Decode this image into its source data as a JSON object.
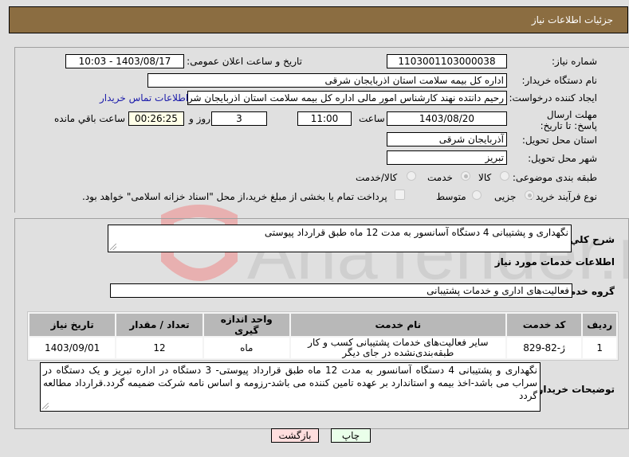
{
  "header": {
    "title": "جزئیات اطلاعات نیاز"
  },
  "fields": {
    "need_number": {
      "label": "شماره نیاز:",
      "value": "1103001103000038"
    },
    "announce_datetime": {
      "label": "تاریخ و ساعت اعلان عمومی:",
      "value": "1403/08/17 - 10:03"
    },
    "buyer_org": {
      "label": "نام دستگاه خریدار:",
      "value": "اداره کل بیمه سلامت استان اذربایجان شرقی"
    },
    "requester": {
      "label": "ایجاد کننده درخواست:",
      "value": "رحیم  دانتده نهند کارشناس امور مالی اداره کل بیمه سلامت استان اذربایجان شرقی"
    },
    "buyer_contact_link": "اطلاعات تماس خریدار",
    "deadline": {
      "label": "مهلت ارسال پاسخ: تا تاریخ:",
      "date": "1403/08/20",
      "time_label": "ساعت",
      "time": "11:00",
      "days": "3",
      "days_label": "روز و",
      "remaining": "00:26:25",
      "remaining_label": "ساعت باقي مانده"
    },
    "province": {
      "label": "استان محل تحویل:",
      "value": "آذربایجان شرقی"
    },
    "city": {
      "label": "شهر محل تحویل:",
      "value": "تبریز"
    },
    "category": {
      "label": "طبقه بندی موضوعی:",
      "options": [
        "کالا",
        "خدمت",
        "کالا/خدمت"
      ],
      "selected": "خدمت"
    },
    "purchase_type": {
      "label": "نوع فرآیند خرید :",
      "options": [
        "جزیی",
        "متوسط"
      ],
      "selected": "جزیی",
      "treasury_checkbox_label": "پرداخت تمام یا بخشی از مبلغ خرید،از محل \"اسناد خزانه اسلامی\" خواهد بود.",
      "treasury_checked": false
    }
  },
  "summary": {
    "label": "شرح کلي نياز:",
    "value": "نگهداری و پشتیبانی 4 دستگاه آسانسور به مدت 12 ماه طبق قرارداد پیوستی"
  },
  "services_section": {
    "title": "اطلاعات خدمات مورد نیاز",
    "group_label": "گروه خدمت:",
    "group_value": "فعالیت‌های اداری و خدمات پشتیبانی",
    "table": {
      "headers": [
        "ردیف",
        "کد خدمت",
        "نام خدمت",
        "واحد اندازه گیری",
        "تعداد / مقدار",
        "تاریخ نیاز"
      ],
      "rows": [
        [
          "1",
          "ژ-82-829",
          "سایر فعالیت‌های خدمات پشتیبانی کسب و کار طبقه‌بندی‌نشده در جای دیگر",
          "ماه",
          "12",
          "1403/09/01"
        ]
      ]
    }
  },
  "buyer_notes": {
    "label": "توضیحات خریدار:",
    "value": "نگهداری و پشتیبانی 4 دستگاه آسانسور به مدت 12 ماه طبق قرارداد پیوستی- 3 دستگاه در اداره تبریز و یک دستگاه در سراب می باشد-اخذ بیمه و استاندارد بر عهده تامین کننده می باشد-رزومه و اساس نامه شرکت ضمیمه گردد.قرارداد مطالعه گردد"
  },
  "buttons": {
    "print": "چاپ",
    "back": "بازگشت"
  },
  "watermark": {
    "text": "AriaTender.net"
  },
  "colors": {
    "header_bg": "#8b6d41",
    "print_bg": "#eaffea",
    "back_bg": "#ffdede",
    "link": "#1a1aaa"
  }
}
